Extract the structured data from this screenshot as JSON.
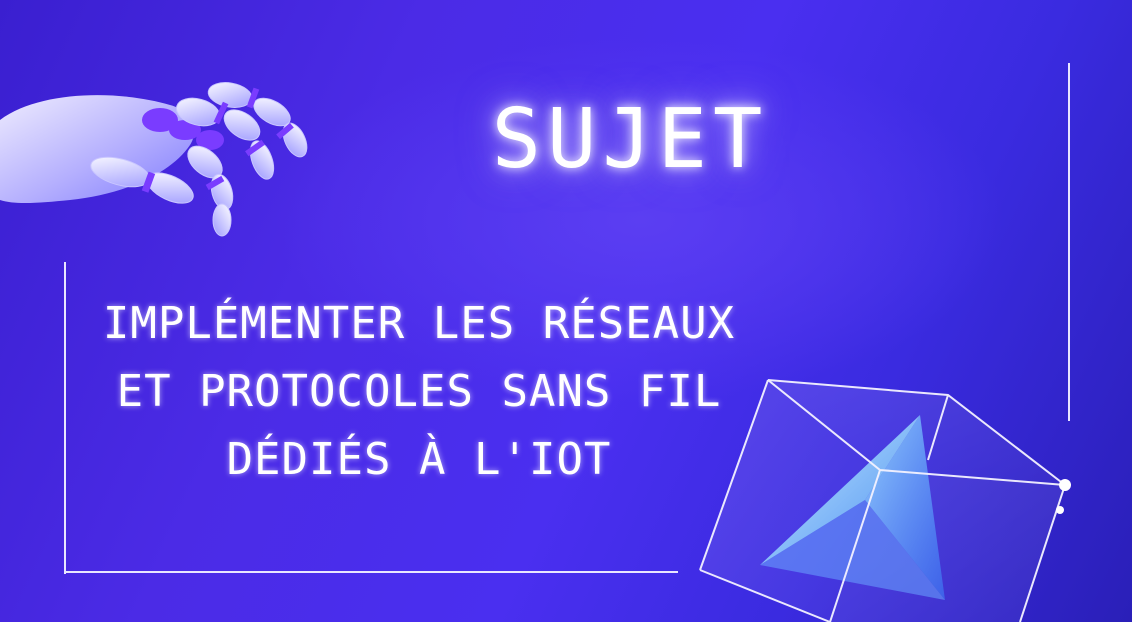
{
  "title": "SUJET",
  "subject_lines": [
    "IMPLÉMENTER LES RÉSEAUX",
    "ET PROTOCOLES SANS FIL",
    "DÉDIÉS À L'IOT"
  ],
  "colors": {
    "background": "#4a2ff0",
    "text": "#ffffff",
    "frame": "#e9e6ff",
    "accent": "#7a3cff"
  },
  "icons": {
    "hand": "robot-hand-icon",
    "cube": "glass-cube-icon"
  }
}
